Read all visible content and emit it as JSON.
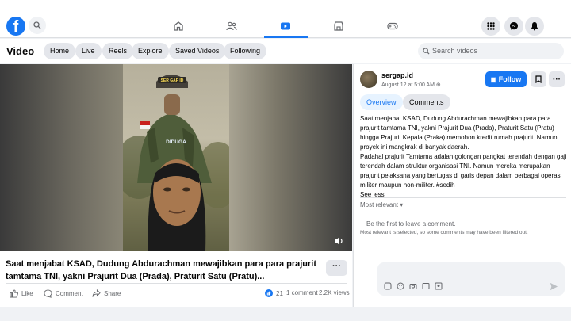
{
  "header": {
    "logo": "f",
    "nav": [
      "home-icon",
      "friends-icon",
      "video-icon",
      "marketplace-icon",
      "gaming-icon"
    ],
    "right_icons": [
      "menu-grid-icon",
      "messenger-icon",
      "bell-icon"
    ]
  },
  "subnav": {
    "title": "Video",
    "chips": [
      "Home",
      "Live",
      "Reels",
      "Explore",
      "Saved Videos",
      "Following"
    ],
    "search_placeholder": "Search videos"
  },
  "player": {
    "helmet_text": "SER GAP ID",
    "shirt_text": "DIDUGA"
  },
  "post": {
    "caption": "Saat menjabat KSAD, Dudung Abdurachman mewajibkan para para prajurit tamtama TNI, yakni Prajurit Dua (Prada), Praturit Satu (Pratu)...",
    "more": "···",
    "like_label": "Like",
    "comment_label": "Comment",
    "share_label": "Share",
    "reactions": "21",
    "comments_count": "1 comment",
    "views": "2.2K views"
  },
  "side": {
    "author": "sergap.id",
    "date": "August 12 at 5:00 AM",
    "follow_label": "Follow",
    "tabs": [
      "Overview",
      "Comments"
    ],
    "description": "Saat menjabat KSAD, Dudung Abdurachman mewajibkan para para prajurit tamtama TNI, yakni Prajurit Dua (Prada), Praturit Satu (Pratu) hingga Prajurit Kepala (Praka) memohon kredit rumah prajurit. Namun proyek ini mangkrak di banyak daerah.",
    "description2": "Padahal prajurit Tamtama adalah golongan pangkat terendah dengan gaji terendah dalam struktur organisasi TNI. Namun mereka merupakan prajurit pelaksana yang bertugas di garis depan dalam berbagai operasi militer maupun non-militer. #sedih",
    "see_less": "See less",
    "most_relevant": "Most relevant",
    "first_comment": "Be the first to leave a comment.",
    "filtered_note": "Most relevant is selected, so some comments may have been filtered out."
  },
  "colors": {
    "brand": "#1877f2",
    "bg": "#f0f2f5"
  }
}
